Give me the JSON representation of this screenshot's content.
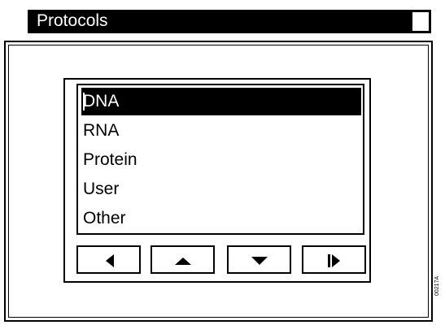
{
  "window": {
    "title": "Protocols"
  },
  "list": {
    "items": [
      {
        "label": "DNA",
        "selected": true
      },
      {
        "label": "RNA",
        "selected": false
      },
      {
        "label": "Protein",
        "selected": false
      },
      {
        "label": "User",
        "selected": false
      },
      {
        "label": "Other",
        "selected": false
      }
    ]
  },
  "buttons": [
    {
      "icon": "left-triangle-icon"
    },
    {
      "icon": "up-triangle-icon"
    },
    {
      "icon": "down-triangle-icon"
    },
    {
      "icon": "skip-right-icon"
    }
  ],
  "margin_code": "00217A"
}
